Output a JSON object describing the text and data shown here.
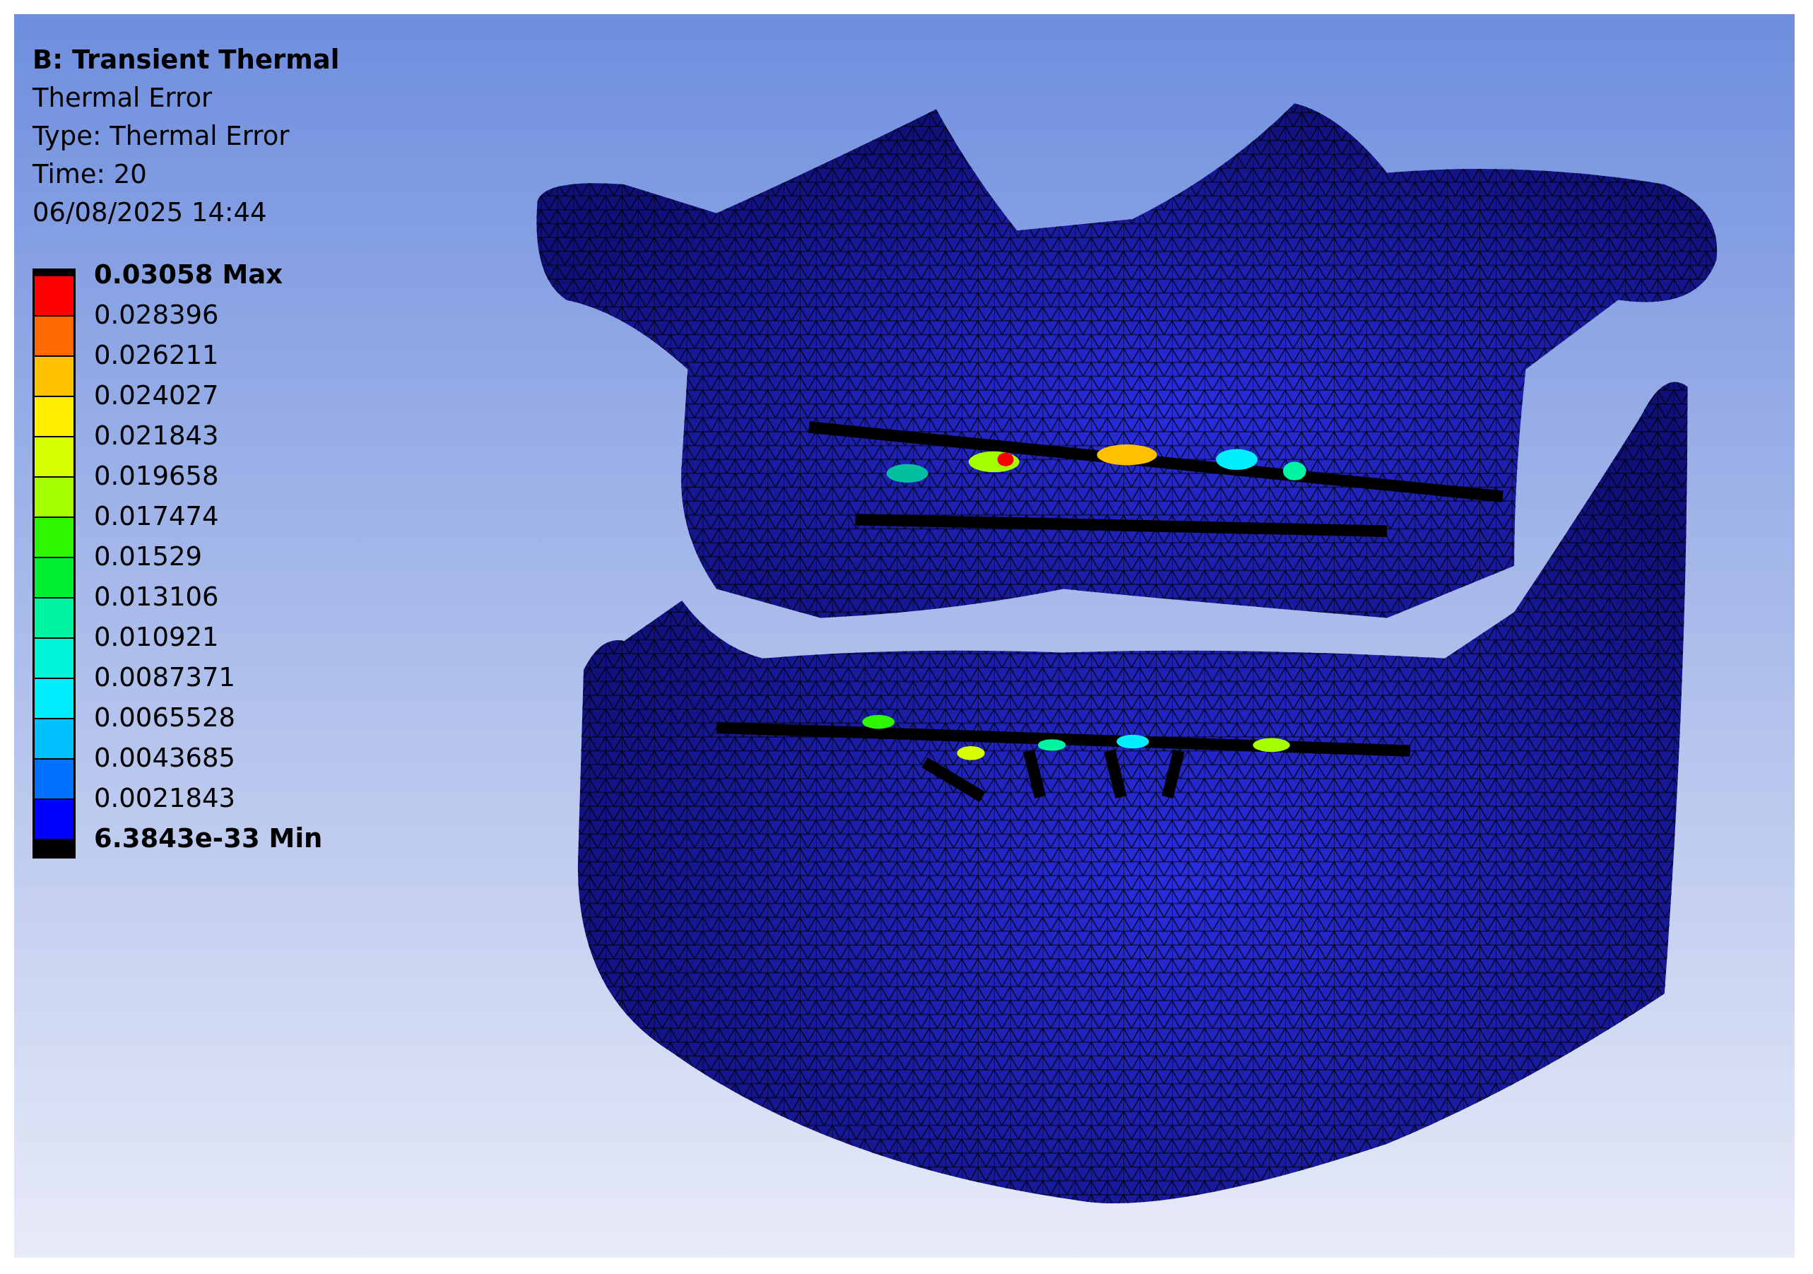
{
  "header": {
    "title": "B: Transient Thermal",
    "lines": [
      "Thermal Error",
      "Type: Thermal Error",
      "Time: 20",
      "06/08/2025 14:44"
    ]
  },
  "legend": {
    "max_label": "0.03058 Max",
    "min_label": "6.3843e-33 Min",
    "labels": [
      "0.028396",
      "0.026211",
      "0.024027",
      "0.021843",
      "0.019658",
      "0.017474",
      "0.01529",
      "0.013106",
      "0.010921",
      "0.0087371",
      "0.0065528",
      "0.0043685",
      "0.0021843"
    ],
    "bands": [
      {
        "color": "#ff0000"
      },
      {
        "color": "#ff6a00"
      },
      {
        "color": "#ffc000"
      },
      {
        "color": "#ffee00"
      },
      {
        "color": "#d8ff00"
      },
      {
        "color": "#a6ff00"
      },
      {
        "color": "#2ef500"
      },
      {
        "color": "#00ee30"
      },
      {
        "color": "#00f5a0"
      },
      {
        "color": "#00f5d8"
      },
      {
        "color": "#00eeff"
      },
      {
        "color": "#00c0ff"
      },
      {
        "color": "#0070ff"
      },
      {
        "color": "#0000ff"
      }
    ]
  }
}
